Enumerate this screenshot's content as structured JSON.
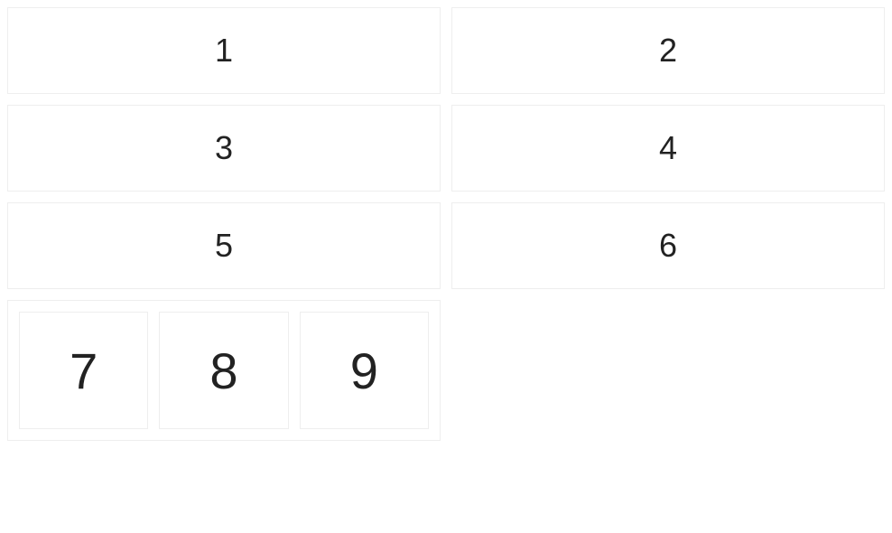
{
  "grid": {
    "cells": [
      "1",
      "2",
      "3",
      "4",
      "5",
      "6"
    ],
    "nested": [
      "7",
      "8",
      "9"
    ]
  }
}
